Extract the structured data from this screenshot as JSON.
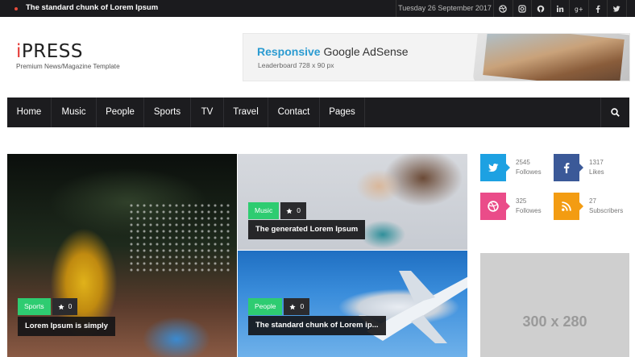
{
  "topbar": {
    "ticker": "The standard chunk of Lorem Ipsum",
    "date": "Tuesday 26 September 2017",
    "socials": [
      "dribbble-icon",
      "instagram-icon",
      "github-icon",
      "linkedin-icon",
      "googleplus-icon",
      "facebook-icon",
      "twitter-icon"
    ]
  },
  "header": {
    "logo_initial": "i",
    "logo_rest": "PRESS",
    "tagline": "Premium News/Magazine Template"
  },
  "ad_banner": {
    "highlight": "Responsive",
    "rest": " Google AdSense",
    "subtitle": "Leaderboard 728 x 90 px"
  },
  "nav": {
    "items": [
      "Home",
      "Music",
      "People",
      "Sports",
      "TV",
      "Travel",
      "Contact",
      "Pages"
    ],
    "search_icon": "search-icon"
  },
  "hero": {
    "posts": [
      {
        "category": "Sports",
        "likes": "0",
        "title": "Lorem Ipsum is simply",
        "category_color": "#2ecc71"
      },
      {
        "category": "Music",
        "likes": "0",
        "title": "The generated Lorem Ipsum",
        "category_color": "#2ecc71"
      },
      {
        "category": "People",
        "likes": "0",
        "title": "The standard chunk of Lorem ip...",
        "category_color": "#2ecc71"
      }
    ]
  },
  "sidebar": {
    "stats": [
      {
        "icon": "twitter-icon",
        "count": "2545",
        "label": "Followes",
        "color": "#1da1e2"
      },
      {
        "icon": "facebook-icon",
        "count": "1317",
        "label": "Likes",
        "color": "#3b5998"
      },
      {
        "icon": "dribbble-icon",
        "count": "325",
        "label": "Followes",
        "color": "#ea4c89"
      },
      {
        "icon": "rss-icon",
        "count": "27",
        "label": "Subscribers",
        "color": "#f39c12"
      }
    ],
    "ad_label": "300 x 280"
  }
}
